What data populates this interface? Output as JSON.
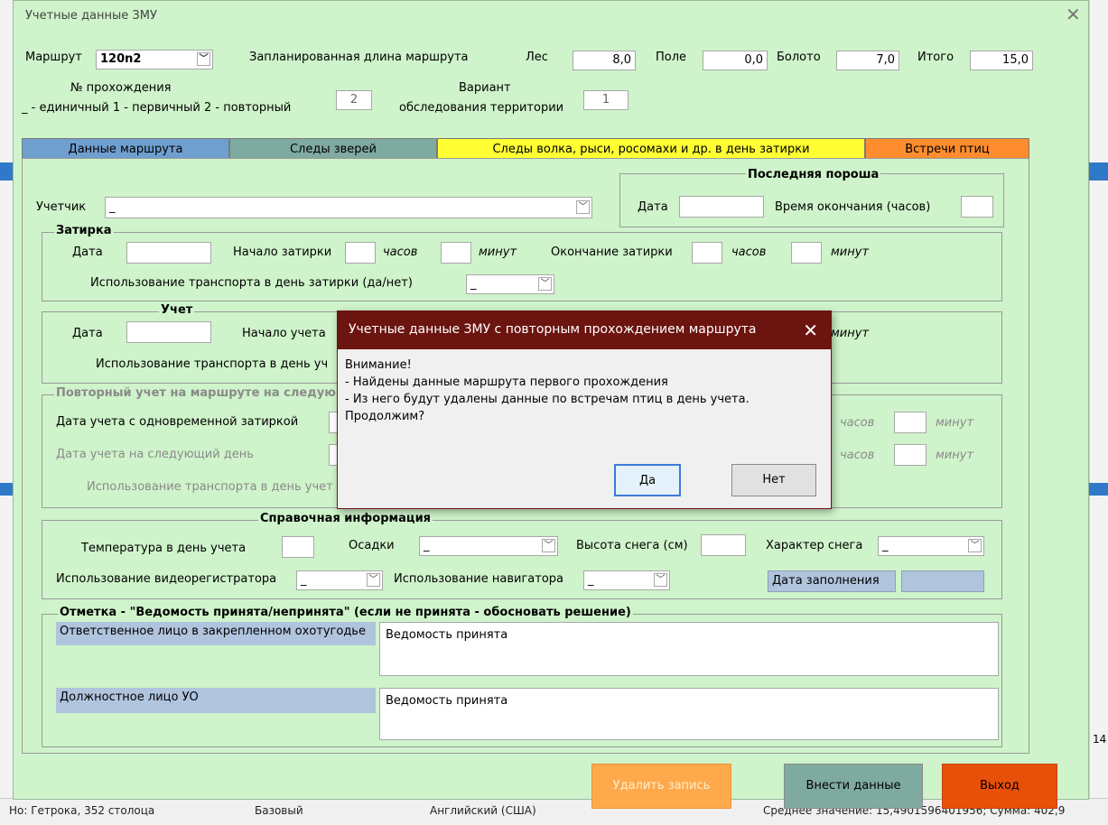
{
  "window": {
    "title": "Учетные данные ЗМУ"
  },
  "header": {
    "route_label": "Маршрут",
    "route_value": "120n2",
    "planned_length_label": "Запланированная длина маршрута",
    "forest_label": "Лес",
    "forest_value": "8,0",
    "field_label": "Поле",
    "field_value": "0,0",
    "swamp_label": "Болото",
    "swamp_value": "7,0",
    "total_label": "Итого",
    "total_value": "15,0",
    "pass_label_1": "№ прохождения",
    "pass_label_2": "_ - единичный 1 - первичный 2 - повторный",
    "pass_value": "2",
    "variant_label_1": "Вариант",
    "variant_label_2": "обследования территории",
    "variant_value": "1"
  },
  "tabs": [
    {
      "label": "Данные маршрута",
      "color": "#6f9fcf"
    },
    {
      "label": "Следы зверей",
      "color": "#7faaa0"
    },
    {
      "label": "Следы волка, рыси, росомахи и др. в день затирки",
      "color": "#ffff33"
    },
    {
      "label": "Встречи птиц",
      "color": "#ff8c2e"
    }
  ],
  "accounting": {
    "counter_label": "Учетчик",
    "counter_value": "_",
    "last_snow_legend": "Последняя пороша",
    "date_label": "Дата",
    "end_time_label": "Время окончания (часов)"
  },
  "zatirka": {
    "legend": "Затирка",
    "date_label": "Дата",
    "start_label": "Начало затирки",
    "hours": "часов",
    "minutes": "минут",
    "end_label": "Окончание затирки",
    "transport_label": "Использование транспорта в день затирки (да/нет)",
    "transport_value": "_"
  },
  "uchet": {
    "legend": "Учет",
    "date_label": "Дата",
    "start_label": "Начало учета",
    "minutes": "минут",
    "transport_label": "Использование транспорта в день уч"
  },
  "repeat": {
    "legend": "Повторный учет на маршруте на следующ",
    "date_same_label": "Дата учета с одновременной затиркой",
    "date_next_label": "Дата учета на следующий день",
    "transport_label": "Использование транспорта в день учет",
    "hours": "часов",
    "minutes": "минут"
  },
  "reference": {
    "legend": "Справочная информация",
    "temp_label": "Температура в день учета",
    "precip_label": "Осадки",
    "precip_value": "_",
    "snow_height_label": "Высота снега (см)",
    "snow_type_label": "Характер снега",
    "snow_type_value": "_",
    "dvr_label": "Использование видеорегистратора",
    "dvr_value": "_",
    "nav_label": "Использование навигатора",
    "nav_value": "_",
    "fill_date_label": "Дата заполнения"
  },
  "mark": {
    "legend": "Отметка - \"Ведомость принята/непринята\" (если не принята - обосновать решение)",
    "responsible_label": "Ответственное лицо в закрепленном охотугодье",
    "responsible_value": "Ведомость принята",
    "official_label": "Должностное лицо УО",
    "official_value": "Ведомость принята"
  },
  "buttons": {
    "delete": "Удалить запись",
    "submit": "Внести данные",
    "exit": "Выход"
  },
  "dialog": {
    "title": "Учетные данные ЗМУ с повторным прохождением маршрута",
    "line1": "Внимание!",
    "line2": "- Найдены данные маршрута первого прохождения",
    "line3": "- Из него будут удалены данные по встречам птиц в день учета.",
    "line4": "Продолжим?",
    "yes": "Да",
    "no": "Нет"
  },
  "background": {
    "status_1": "Но: Гетрока, 352 столоца",
    "status_2": "Базовый",
    "status_3": "Английский (США)",
    "status_4": "Среднее значение: 15,4901596401956; Сумма: 402,9",
    "right_num": "14"
  }
}
